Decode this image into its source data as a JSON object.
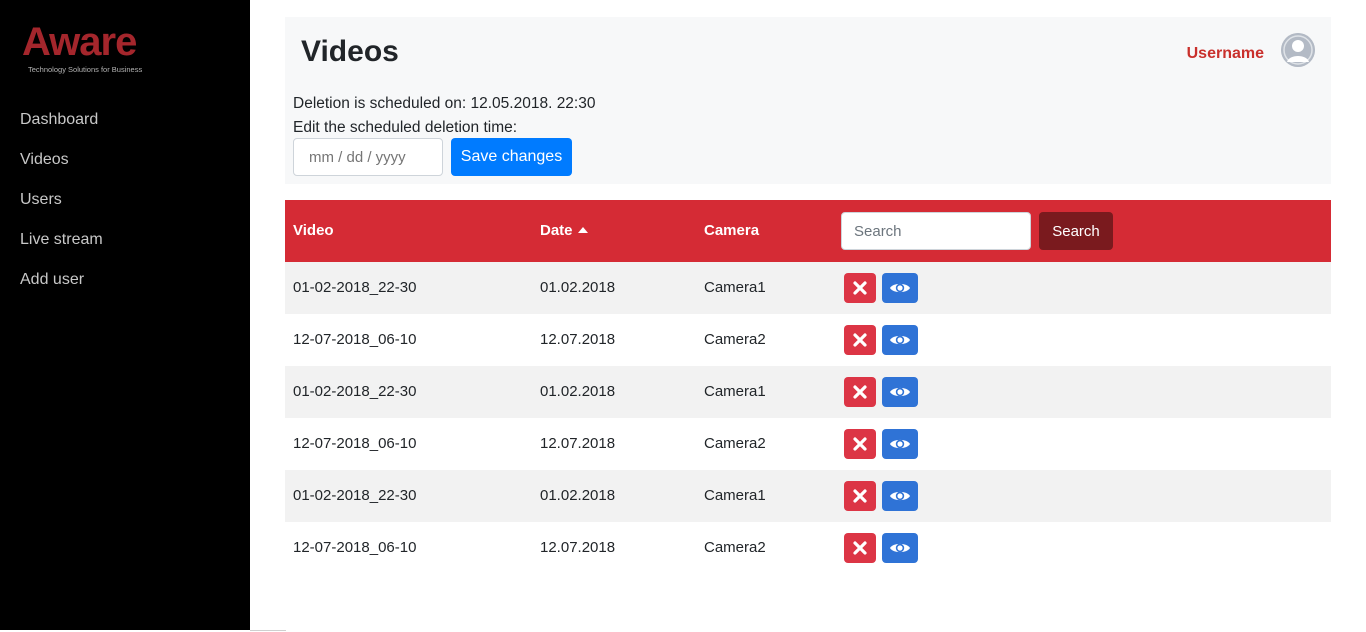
{
  "brand": {
    "name": "Aware",
    "tagline": "Technology Solutions for Business"
  },
  "sidebar": {
    "items": [
      {
        "label": "Dashboard"
      },
      {
        "label": "Videos"
      },
      {
        "label": "Users"
      },
      {
        "label": "Live stream"
      },
      {
        "label": "Add user"
      }
    ]
  },
  "header": {
    "title": "Videos",
    "username": "Username",
    "deletion_info": "Deletion is scheduled on: 12.05.2018. 22:30",
    "edit_label": "Edit the scheduled deletion time:",
    "date_placeholder": "mm / dd / yyyy",
    "save_label": "Save changes"
  },
  "table": {
    "columns": {
      "video": "Video",
      "date": "Date",
      "camera": "Camera"
    },
    "search_placeholder": "Search",
    "search_button": "Search",
    "rows": [
      {
        "video": "01-02-2018_22-30",
        "date": "01.02.2018",
        "camera": "Camera1"
      },
      {
        "video": "12-07-2018_06-10",
        "date": "12.07.2018",
        "camera": "Camera2"
      },
      {
        "video": "01-02-2018_22-30",
        "date": "01.02.2018",
        "camera": "Camera1"
      },
      {
        "video": "12-07-2018_06-10",
        "date": "12.07.2018",
        "camera": "Camera2"
      },
      {
        "video": "01-02-2018_22-30",
        "date": "01.02.2018",
        "camera": "Camera1"
      },
      {
        "video": "12-07-2018_06-10",
        "date": "12.07.2018",
        "camera": "Camera2"
      }
    ]
  },
  "icons": {
    "delete": "close-icon",
    "view": "eye-icon",
    "avatar": "user-avatar-icon",
    "sort": "sort-ascending-icon"
  },
  "colors": {
    "brand_red": "#a4262c",
    "table_header": "#d52b35",
    "search_button": "#7a1a1e",
    "primary": "#007bff",
    "delete": "#dc3545",
    "view": "#2f73d6",
    "username": "#c9302c"
  }
}
